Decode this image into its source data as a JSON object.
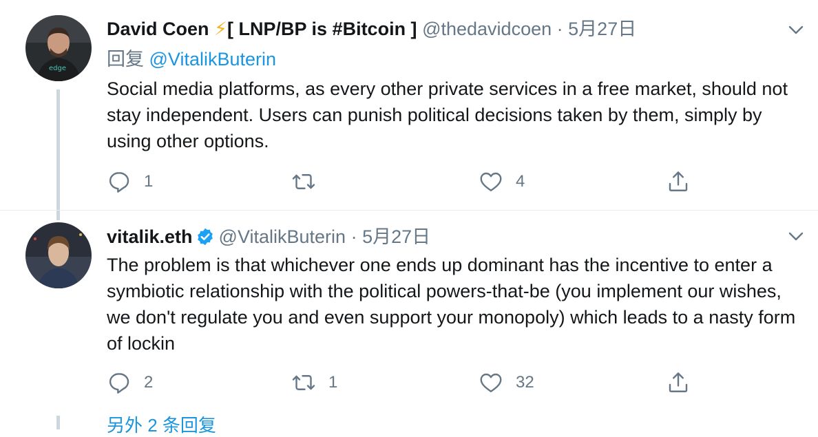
{
  "colors": {
    "text": "#14171a",
    "secondary": "#657786",
    "link": "#1b95e0",
    "verified": "#1da1f2",
    "bolt": "#f7b21b",
    "thread_line": "#ccd6dd"
  },
  "tweets": [
    {
      "name": "David Coen",
      "name_suffix_icon": "lightning-bolt-icon",
      "name_suffix": "[ LNP/BP is #Bitcoin ]",
      "handle": "@thedavidcoen",
      "separator": "·",
      "date": "5月27日",
      "reply_label": "回复",
      "reply_to": "@VitalikButerin",
      "text": "Social media platforms, as every other private services in a free market, should not stay independent. Users can punish political decisions taken by them, simply by using other options.",
      "reply_count": "1",
      "retweet_count": "",
      "like_count": "4"
    },
    {
      "name": "vitalik.eth",
      "verified_icon": "verified-badge-icon",
      "handle": "@VitalikButerin",
      "separator": "·",
      "date": "5月27日",
      "text": "The problem is that whichever one ends up dominant has the incentive to enter a symbiotic relationship with the political powers-that-be (you implement our wishes, we don't regulate you and even support your monopoly) which leads to a nasty form of lockin",
      "reply_count": "2",
      "retweet_count": "1",
      "like_count": "32"
    }
  ],
  "more_replies": "另外 2 条回复"
}
